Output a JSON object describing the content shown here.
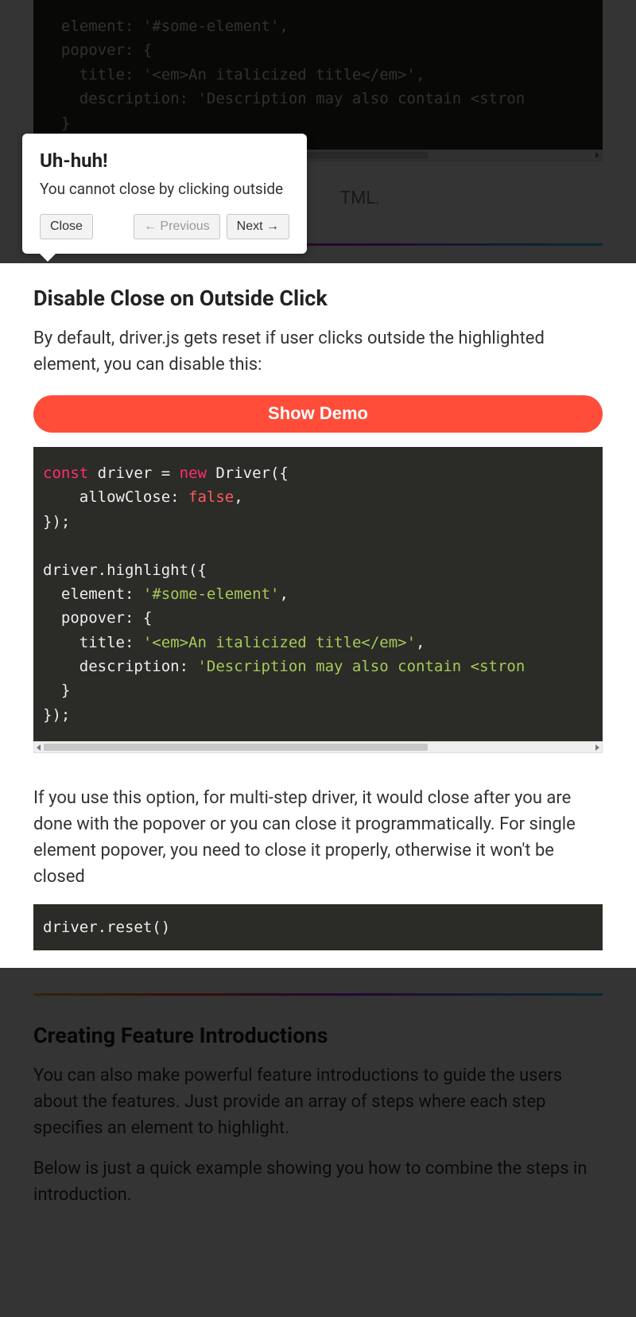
{
  "top_code": "  element: '#some-element',\n  popover: {\n    title: '<em>An italicized title</em>',\n    description: 'Description may also contain <stron\n  }\n",
  "popover_hint": "TML.",
  "popover": {
    "title": "Uh-huh!",
    "body": "You cannot close by clicking outside",
    "close": "Close",
    "prev": "← Previous",
    "next": "Next →"
  },
  "disable_section": {
    "heading": "Disable Close on Outside Click",
    "intro": "By default, driver.js gets reset if user clicks outside the highlighted element, you can disable this:",
    "demo_btn": "Show Demo",
    "note": "If you use this option, for multi-step driver, it would close after you are done with the popover or you can close it programmatically. For single element popover, you need to close it properly, otherwise it won't be closed",
    "reset_code": "driver.reset()"
  },
  "code2": {
    "l1a": "const",
    "l1b": " driver = ",
    "l1c": "new",
    "l1d": " Driver({",
    "l2a": "    allowClose: ",
    "l2b": "false",
    "l2c": ",",
    "l3": "});",
    "l4": "",
    "l5": "driver.highlight({",
    "l6a": "  element: ",
    "l6b": "'#some-element'",
    "l6c": ",",
    "l7": "  popover: {",
    "l8a": "    title: ",
    "l8b": "'<em>An italicized title</em>'",
    "l8c": ",",
    "l9a": "    description: ",
    "l9b": "'Description may also contain <stron",
    "l10": "  }",
    "l11": "});"
  },
  "feature_section": {
    "heading": "Creating Feature Introductions",
    "p1": "You can also make powerful feature introductions to guide the users about the features. Just provide an array of steps where each step specifies an element to highlight.",
    "p2": "Below is just a quick example showing you how to combine the steps in introduction."
  }
}
